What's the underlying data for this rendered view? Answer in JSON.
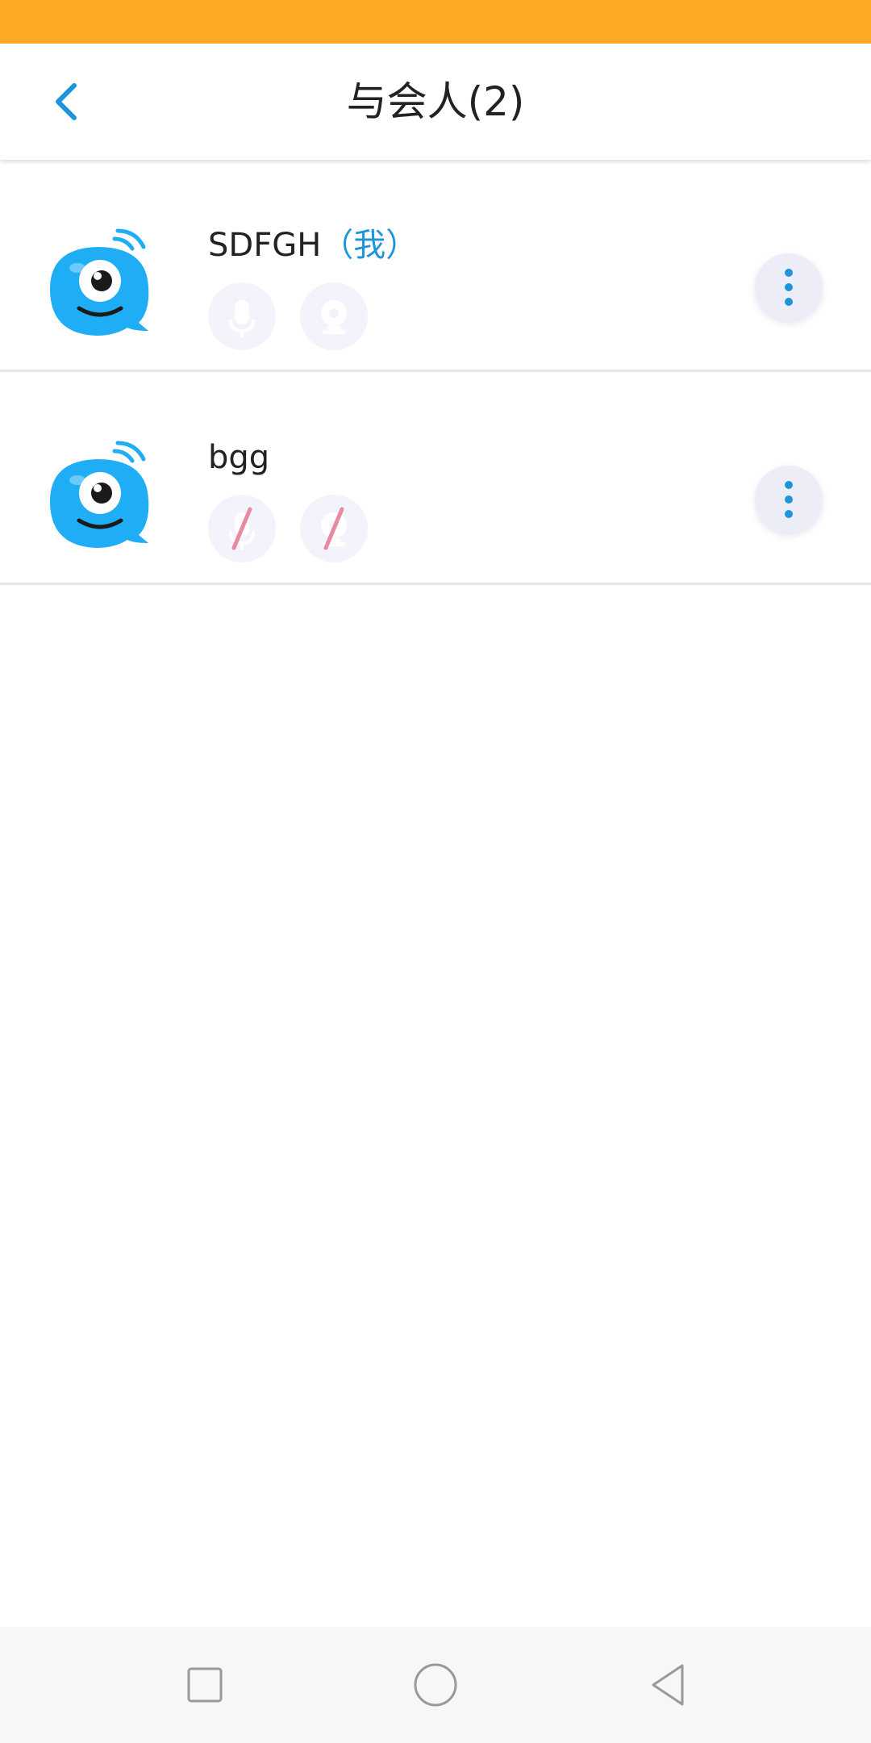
{
  "header": {
    "title": "与会人(2)",
    "back_icon": "chevron-left-icon"
  },
  "participants": [
    {
      "name": "SDFGH",
      "tag": "（我）",
      "mic_muted": false,
      "camera_off": false
    },
    {
      "name": "bgg",
      "tag": "",
      "mic_muted": true,
      "camera_off": true
    }
  ],
  "colors": {
    "status_bar": "#FFA926",
    "accent": "#1E95DB",
    "avatar_blue": "#1FAEF5",
    "muted_slash": "#E88AA0"
  },
  "navbar": {
    "icons": [
      "recent-apps-icon",
      "home-icon",
      "back-icon"
    ]
  }
}
